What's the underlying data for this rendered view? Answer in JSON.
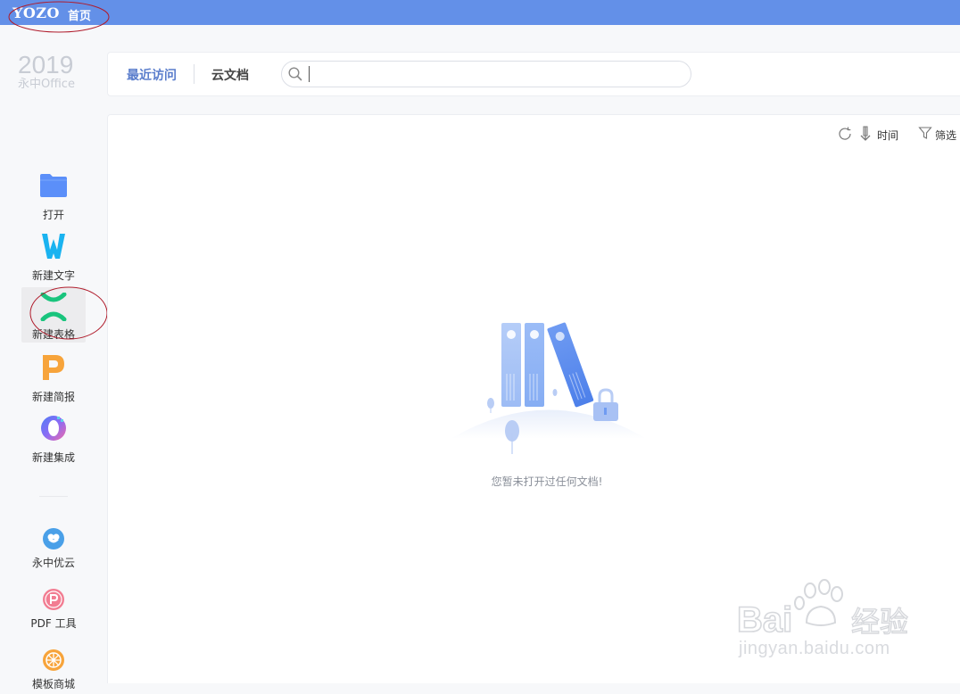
{
  "titlebar": {
    "logo": "YOZO",
    "home_label": "首页"
  },
  "brand": {
    "year": "2019",
    "name": "永中Office"
  },
  "sidebar": {
    "items": [
      {
        "label": "打开",
        "icon": "folder-icon",
        "color": "#5b8ff9"
      },
      {
        "label": "新建文字",
        "icon": "word-w-icon",
        "color": "#1ab3f0"
      },
      {
        "label": "新建表格",
        "icon": "spreadsheet-x-icon",
        "color": "#19c47d"
      },
      {
        "label": "新建简报",
        "icon": "presentation-p-icon",
        "color": "#f7a43b"
      },
      {
        "label": "新建集成",
        "icon": "integrated-o-icon",
        "color": "#8b6cf5"
      }
    ],
    "tools": [
      {
        "label": "永中优云",
        "icon": "cloud-icon",
        "color": "#4aa0e8"
      },
      {
        "label": "PDF 工具",
        "icon": "pdf-icon",
        "color": "#f0607a"
      },
      {
        "label": "模板商城",
        "icon": "orange-slice-icon",
        "color": "#f7a43b"
      }
    ]
  },
  "tabs": [
    {
      "label": "最近访问",
      "active": true
    },
    {
      "label": "云文档",
      "active": false
    }
  ],
  "search": {
    "value": "",
    "placeholder": ""
  },
  "toolbar": {
    "sort_label": "时间",
    "filter_label": "筛选"
  },
  "empty_state": {
    "message": "您暂未打开过任何文档!"
  },
  "watermark": {
    "text": "jingyan.baidu.com",
    "brand": "Bai du 经验"
  },
  "colors": {
    "accent": "#6390e8",
    "tab_active": "#5a7dcc"
  }
}
